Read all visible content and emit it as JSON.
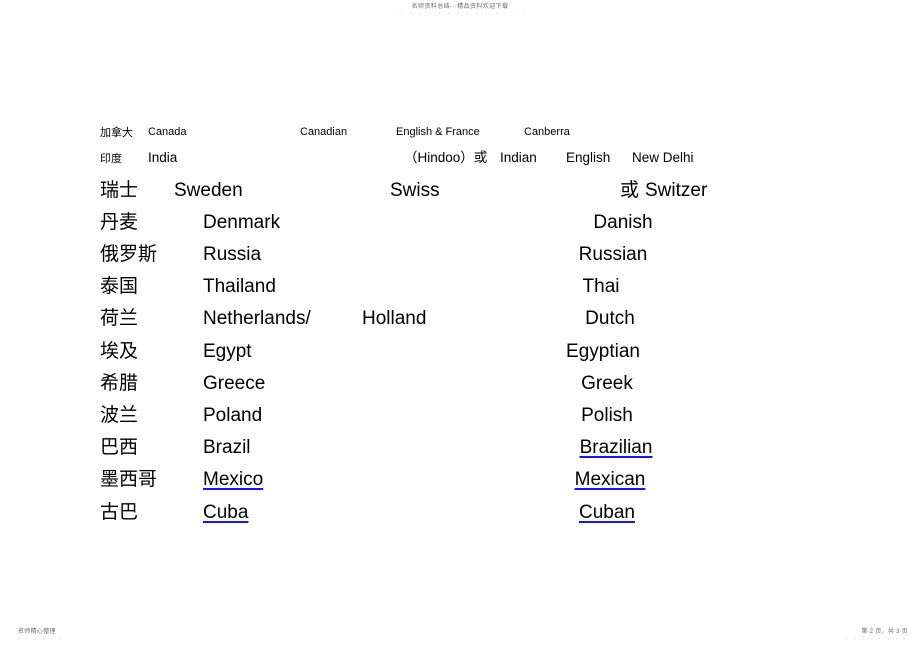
{
  "header": {
    "watermark_text": "名师资料总结···精品资料欢迎下载",
    "dots": "· · · · · · · · · · · · · · ·"
  },
  "footer": {
    "left_text": "名师精心整理",
    "left_dots": "· · · · · ·",
    "right_text": "第 2 页，共 3 页",
    "right_dots": "· · · · · · · ·"
  },
  "colors": {
    "link_underline": "#1414ff",
    "text": "#000000",
    "watermark": "#6a6a6a",
    "background": "#ffffff"
  },
  "table": {
    "rows": [
      {
        "chinese": "加拿大",
        "country": "Canada",
        "nationality": "Canadian",
        "language": "English & France",
        "capital": "Canberra",
        "size": "small"
      },
      {
        "chinese": "印度",
        "country": "India",
        "nationality_note": "（Hindoo）或",
        "nationality": "Indian",
        "language": "English",
        "capital": "New Delhi",
        "size": "small"
      },
      {
        "chinese": "瑞士",
        "country": "Sweden",
        "nationality": "Swiss",
        "alt_prefix": "或",
        "alt_nationality": "Switzer",
        "size": "large"
      },
      {
        "chinese": "丹麦",
        "country": "Denmark",
        "nationality": "Danish",
        "size": "large"
      },
      {
        "chinese": "俄罗斯",
        "country": "Russia",
        "nationality": "Russian",
        "size": "large"
      },
      {
        "chinese": "泰国",
        "country": "Thailand",
        "nationality": "Thai",
        "size": "large"
      },
      {
        "chinese": "荷兰",
        "country": "Netherlands/",
        "country_alt": "Holland",
        "nationality": "Dutch",
        "size": "large"
      },
      {
        "chinese": "埃及",
        "country": "Egypt",
        "nationality": "Egyptian",
        "size": "large"
      },
      {
        "chinese": "希腊",
        "country": "Greece",
        "nationality": "Greek",
        "size": "large"
      },
      {
        "chinese": "波兰",
        "country": "Poland",
        "nationality": "Polish",
        "size": "large"
      },
      {
        "chinese": "巴西",
        "country": "Brazil",
        "nationality": "Brazilian ",
        "nationality_is_link": true,
        "size": "large"
      },
      {
        "chinese": "墨西哥",
        "country": "Mexico ",
        "country_is_link": true,
        "nationality": "Mexican",
        "nationality_is_link": true,
        "size": "large"
      },
      {
        "chinese": "古巴",
        "country": "Cuba ",
        "country_is_link": true,
        "nationality": "Cuban",
        "nationality_is_link": true,
        "size": "large"
      }
    ]
  }
}
